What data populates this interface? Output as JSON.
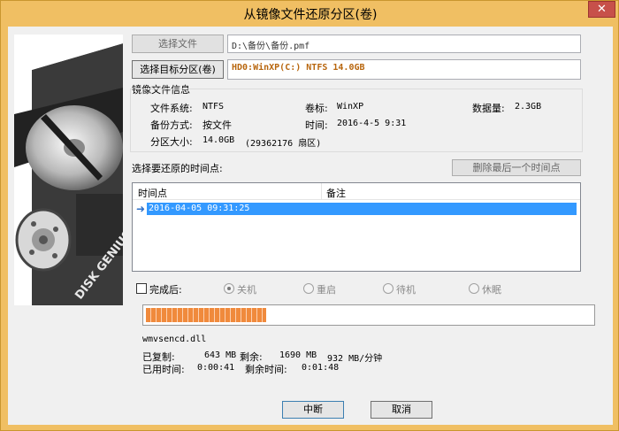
{
  "window": {
    "title": "从镜像文件还原分区(卷)",
    "close_glyph": "✕"
  },
  "source": {
    "select_file_label": "选择文件",
    "file_path": "D:\\备份\\备份.pmf",
    "select_target_label": "选择目标分区(卷)",
    "target_value": "HD0:WinXP(C:) NTFS 14.0GB"
  },
  "image_info": {
    "title": "镜像文件信息",
    "fs_label": "文件系统:",
    "fs_value": "NTFS",
    "volume_label": "卷标:",
    "volume_value": "WinXP",
    "data_label": "数据量:",
    "data_value": "2.3GB",
    "method_label": "备份方式:",
    "method_value": "按文件",
    "time_label": "时间:",
    "time_value": "2016-4-5 9:31",
    "size_label": "分区大小:",
    "size_value": "14.0GB",
    "sectors_value": "(29362176 扇区)"
  },
  "restore_point": {
    "prompt": "选择要还原的时间点:",
    "delete_last_label": "删除最后一个时间点",
    "columns": [
      "时间点",
      "备注"
    ],
    "rows": [
      {
        "time": "2016-04-05 09:31:25",
        "note": ""
      }
    ]
  },
  "after_complete": {
    "label": "完成后:",
    "checked": false,
    "options": [
      {
        "label": "关机",
        "selected": true
      },
      {
        "label": "重启",
        "selected": false
      },
      {
        "label": "待机",
        "selected": false
      },
      {
        "label": "休眠",
        "selected": false
      }
    ]
  },
  "progress": {
    "fraction": 0.27,
    "current_file": "wmvsencd.dll"
  },
  "stats": {
    "copied_label": "已复制:",
    "copied_value": "643 MB",
    "remain_label": "剩余:",
    "remain_value": "1690 MB",
    "speed_value": "932 MB/分钟",
    "elapsed_label": "已用时间:",
    "elapsed_value": "0:00:41",
    "remain_time_label": "剩余时间:",
    "remain_time_value": "0:01:48"
  },
  "actions": {
    "abort_label": "中断",
    "cancel_label": "取消"
  },
  "logo": {
    "text": "DISK GENIUS"
  },
  "colors": {
    "titlebar": "#f0bf63",
    "close": "#c7504a",
    "selection": "#3399ff",
    "progress": "#f08a3c",
    "target_text": "#b8660e"
  }
}
